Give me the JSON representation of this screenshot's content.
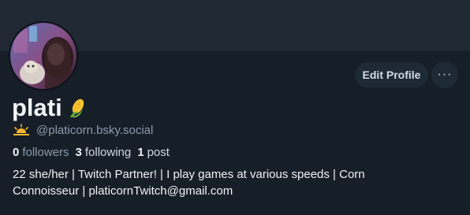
{
  "profile": {
    "display_name": "plati",
    "name_emoji": "corn-icon",
    "handle_emoji": "sunrise-icon",
    "handle": "@platicorn.bsky.social",
    "bio_line1": "22 she/her | Twitch Partner! | I play games at various speeds | Corn",
    "bio_line2": "Connoisseur | platicornTwitch@gmail.com"
  },
  "stats": {
    "followers_count": "0",
    "followers_label": "followers",
    "following_count": "3",
    "following_label": "following",
    "posts_count": "1",
    "posts_label": "post"
  },
  "actions": {
    "edit_profile_label": "Edit Profile",
    "more_label": "···"
  },
  "colors": {
    "background": "#161e27",
    "banner": "#1f2833",
    "button_bg": "#1e2936",
    "text_primary": "#f1f3f5",
    "text_secondary": "#8d9cad"
  }
}
